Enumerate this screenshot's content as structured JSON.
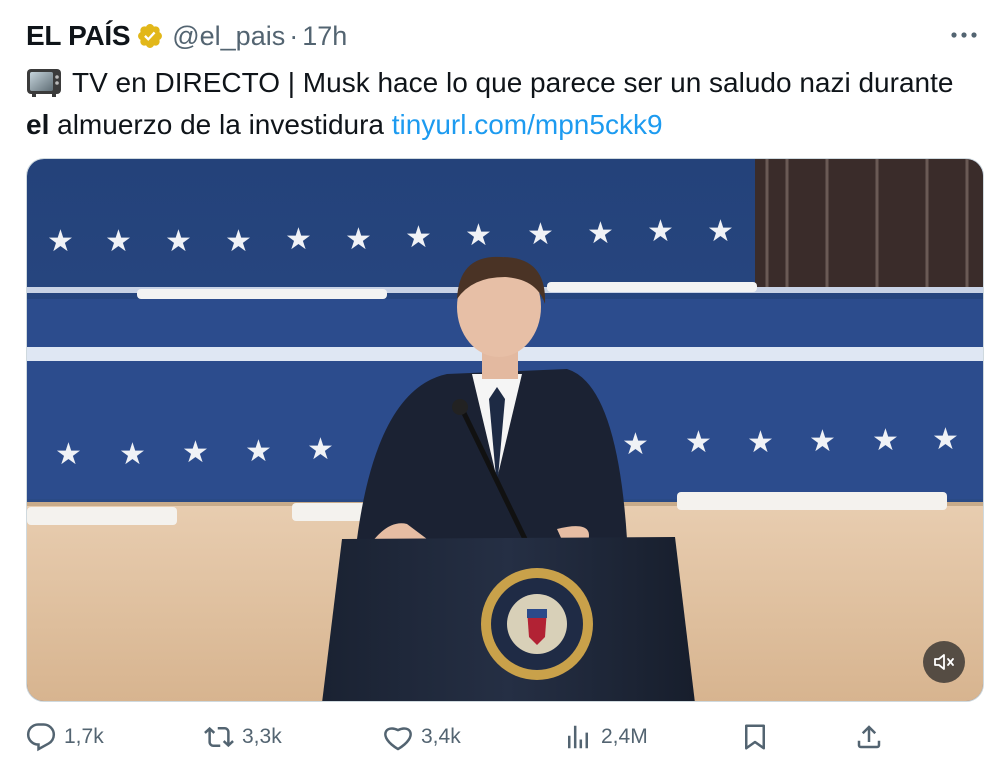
{
  "tweet": {
    "author_name": "EL PAÍS",
    "handle": "@el_pais",
    "separator": "·",
    "time": "17h",
    "text_part1": "TV en DIRECTO | Musk hace lo que parece ser un saludo nazi durante ",
    "text_bold": "el",
    "text_part2": " almuerzo de la investidura ",
    "link": "tinyurl.com/mpn5ckk9"
  },
  "actions": {
    "replies": "1,7k",
    "reposts": "3,3k",
    "likes": "3,4k",
    "views": "2,4M"
  },
  "colors": {
    "accent_link": "#1d9bf0",
    "secondary_text": "#536471",
    "verified_gold": "#e2b719"
  },
  "icons": [
    "verified-badge-icon",
    "more-icon",
    "tv-emoji-icon",
    "mute-icon",
    "reply-icon",
    "repost-icon",
    "like-icon",
    "views-icon",
    "bookmark-icon",
    "share-icon"
  ]
}
